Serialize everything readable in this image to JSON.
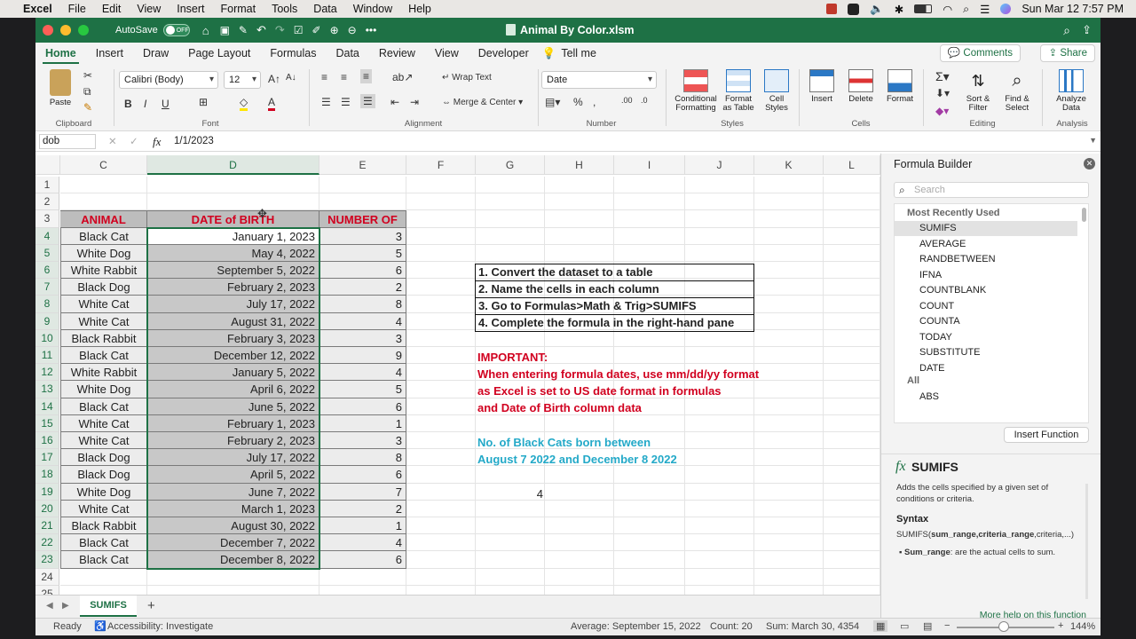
{
  "mac_menu": {
    "app": "Excel",
    "items": [
      "File",
      "Edit",
      "View",
      "Insert",
      "Format",
      "Tools",
      "Data",
      "Window",
      "Help"
    ],
    "clock": "Sun Mar 12  7:57 PM"
  },
  "window": {
    "autosave_label": "AutoSave",
    "autosave_state": "OFF",
    "file_title": "Animal By Color.xlsm"
  },
  "ribbon_tabs": [
    "Home",
    "Insert",
    "Draw",
    "Page Layout",
    "Formulas",
    "Data",
    "Review",
    "View",
    "Developer"
  ],
  "tell_me": "Tell me",
  "comments_label": "Comments",
  "share_label": "Share",
  "ribbon": {
    "paste": "Paste",
    "clipboard": "Clipboard",
    "font_name": "Calibri (Body)",
    "font_size": "12",
    "font_group": "Font",
    "wrap_text": "Wrap Text",
    "merge_center": "Merge & Center",
    "alignment": "Alignment",
    "number_format": "Date",
    "number": "Number",
    "cond_fmt_1": "Conditional",
    "cond_fmt_2": "Formatting",
    "fmt_table_1": "Format",
    "fmt_table_2": "as Table",
    "cell_styles_1": "Cell",
    "cell_styles_2": "Styles",
    "styles": "Styles",
    "insert": "Insert",
    "delete": "Delete",
    "format": "Format",
    "cells": "Cells",
    "sort_1": "Sort &",
    "sort_2": "Filter",
    "find_1": "Find &",
    "find_2": "Select",
    "editing": "Editing",
    "analyze_1": "Analyze",
    "analyze_2": "Data",
    "analysis": "Analysis"
  },
  "formula_bar": {
    "name_box": "dob",
    "fx": "fx",
    "value": "1/1/2023"
  },
  "columns": [
    "C",
    "D",
    "E",
    "F",
    "G",
    "H",
    "I",
    "J",
    "K",
    "L"
  ],
  "table_headers": {
    "animal": "ANIMAL",
    "dob": "DATE of BIRTH",
    "number": "NUMBER OF"
  },
  "rows": [
    {
      "animal": "Black Cat",
      "dob": "January 1, 2023",
      "number": "3"
    },
    {
      "animal": "White Dog",
      "dob": "May 4, 2022",
      "number": "5"
    },
    {
      "animal": "White Rabbit",
      "dob": "September 5, 2022",
      "number": "6"
    },
    {
      "animal": "Black Dog",
      "dob": "February 2, 2023",
      "number": "2"
    },
    {
      "animal": "White Cat",
      "dob": "July 17, 2022",
      "number": "8"
    },
    {
      "animal": "White Cat",
      "dob": "August 31, 2022",
      "number": "4"
    },
    {
      "animal": "Black Rabbit",
      "dob": "February 3, 2023",
      "number": "3"
    },
    {
      "animal": "Black Cat",
      "dob": "December 12, 2022",
      "number": "9"
    },
    {
      "animal": "White Rabbit",
      "dob": "January 5, 2022",
      "number": "4"
    },
    {
      "animal": "White Dog",
      "dob": "April 6, 2022",
      "number": "5"
    },
    {
      "animal": "Black Cat",
      "dob": "June 5, 2022",
      "number": "6"
    },
    {
      "animal": "White Cat",
      "dob": "February 1, 2023",
      "number": "1"
    },
    {
      "animal": "White Cat",
      "dob": "February 2, 2023",
      "number": "3"
    },
    {
      "animal": "Black Dog",
      "dob": "July 17, 2022",
      "number": "8"
    },
    {
      "animal": "Black Dog",
      "dob": "April 5, 2022",
      "number": "6"
    },
    {
      "animal": "White Dog",
      "dob": "June 7, 2022",
      "number": "7"
    },
    {
      "animal": "White Cat",
      "dob": "March 1, 2023",
      "number": "2"
    },
    {
      "animal": "Black Rabbit",
      "dob": "August 30, 2022",
      "number": "1"
    },
    {
      "animal": "Black Cat",
      "dob": "December 7, 2022",
      "number": "4"
    },
    {
      "animal": "Black Cat",
      "dob": "December 8, 2022",
      "number": "6"
    }
  ],
  "instructions": [
    "1. Convert the dataset to a table",
    "2. Name the cells in each column",
    "3. Go to Formulas>Math & Trig>SUMIFS",
    "4. Complete the formula in the right-hand pane"
  ],
  "important": [
    "IMPORTANT:",
    "When entering formula dates, use mm/dd/yy format",
    "as Excel is set to US date format in formulas",
    "and Date of Birth column data"
  ],
  "question": [
    "No. of Black Cats born between",
    "August 7 2022 and December 8 2022"
  ],
  "result": "4",
  "formula_builder": {
    "title": "Formula Builder",
    "search_placeholder": "Search",
    "recent_heading": "Most Recently Used",
    "functions": [
      "SUMIFS",
      "AVERAGE",
      "RANDBETWEEN",
      "IFNA",
      "COUNTBLANK",
      "COUNT",
      "COUNTA",
      "TODAY",
      "SUBSTITUTE",
      "DATE"
    ],
    "all_heading": "All",
    "all_first": "ABS",
    "insert_button": "Insert Function",
    "fx_symbol": "fx",
    "selected_name": "SUMIFS",
    "description": "Adds the cells specified by a given set of conditions or criteria.",
    "syntax_heading": "Syntax",
    "syntax_fn": "SUMIFS(",
    "syntax_bold": "sum_range,criteria_range",
    "syntax_rest": ",criteria,...)",
    "arg_name": "Sum_range",
    "arg_desc": ": are the actual cells to sum.",
    "help_link": "More help on this function"
  },
  "sheet_tab": "SUMIFS",
  "status": {
    "ready": "Ready",
    "accessibility": "Accessibility: Investigate",
    "average": "Average: September 15, 2022",
    "count": "Count: 20",
    "sum": "Sum: March 30, 4354",
    "zoom": "144%"
  },
  "colors": {
    "accent_green": "#1e7145",
    "header_red": "#d1001f",
    "question_blue": "#23a9c8",
    "header_fill": "#bdbdbd",
    "selection_fill": "#c8c8c8"
  }
}
